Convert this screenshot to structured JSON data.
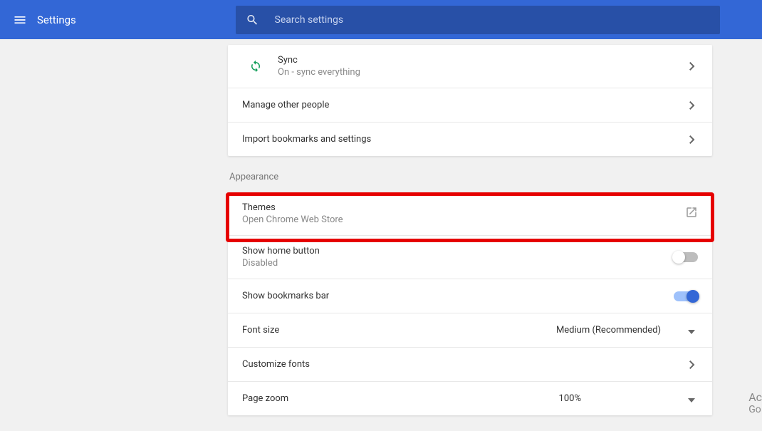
{
  "header": {
    "title": "Settings",
    "search_placeholder": "Search settings"
  },
  "people_section": {
    "sync": {
      "title": "Sync",
      "sub": "On - sync everything"
    },
    "manage": {
      "title": "Manage other people"
    },
    "import": {
      "title": "Import bookmarks and settings"
    }
  },
  "appearance": {
    "header": "Appearance",
    "themes": {
      "title": "Themes",
      "sub": "Open Chrome Web Store"
    },
    "home_button": {
      "title": "Show home button",
      "sub": "Disabled"
    },
    "bookmarks_bar": {
      "title": "Show bookmarks bar"
    },
    "font_size": {
      "title": "Font size",
      "value": "Medium (Recommended)"
    },
    "customize_fonts": {
      "title": "Customize fonts"
    },
    "page_zoom": {
      "title": "Page zoom",
      "value": "100%"
    }
  },
  "watermark": {
    "line1": "Ac",
    "line2": "Go"
  }
}
